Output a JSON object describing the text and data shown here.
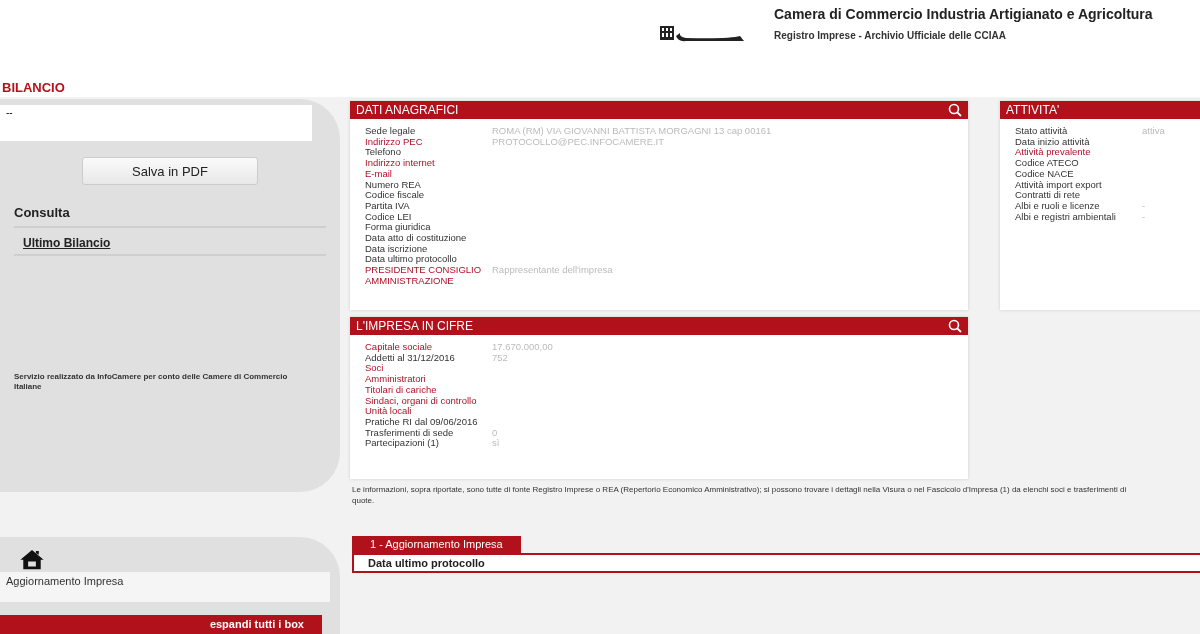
{
  "header": {
    "title": "Camera di Commercio Industria Artigianato e Agricoltura",
    "subtitle": "Registro Imprese - Archivio Ufficiale delle CCIAA"
  },
  "page_title": "BILANCIO",
  "sidebar": {
    "company_line": "--",
    "save_button": "Salva in PDF",
    "section_title": "Consulta",
    "links": [
      {
        "label": "Ultimo Bilancio",
        "selected": true
      }
    ],
    "footer_note": "Servizio realizzato da InfoCamere per conto delle Camere di Commercio Italiane"
  },
  "sidebar_bottom": {
    "item": "Aggiornamento Impresa",
    "expand_button": "espandi tutti i box"
  },
  "dati_anagrafici": {
    "title": "DATI ANAGRAFICI",
    "rows": [
      {
        "label": "Sede legale",
        "kind": "plain",
        "value": "ROMA  (RM) VIA GIOVANNI BATTISTA MORGAGNI 13  cap 00161"
      },
      {
        "label": "Indirizzo PEC",
        "kind": "link",
        "value": "PROTOCOLLO@PEC.INFOCAMERE.IT"
      },
      {
        "label": "Telefono",
        "kind": "plain"
      },
      {
        "label": "Indirizzo internet",
        "kind": "link"
      },
      {
        "label": "E-mail",
        "kind": "link"
      },
      {
        "label": "Numero REA",
        "kind": "plain"
      },
      {
        "label": "Codice fiscale",
        "kind": "plain"
      },
      {
        "label": "Partita IVA",
        "kind": "plain"
      },
      {
        "label": "Codice LEI",
        "kind": "plain"
      },
      {
        "label": "Forma giuridica",
        "kind": "plain"
      },
      {
        "label": "Data atto di costituzione",
        "kind": "plain"
      },
      {
        "label": "Data iscrizione",
        "kind": "plain"
      },
      {
        "label": "Data ultimo protocollo",
        "kind": "plain"
      },
      {
        "label": "PRESIDENTE CONSIGLIO AMMINISTRAZIONE",
        "kind": "link",
        "value": "Rappresentante dell'impresa"
      }
    ]
  },
  "attivita": {
    "title": "ATTIVITA'",
    "rows": [
      {
        "label": "Stato attività",
        "kind": "plain",
        "value": "attiva"
      },
      {
        "label": "Data inizio attività",
        "kind": "plain"
      },
      {
        "label": "Attività prevalente",
        "kind": "link"
      },
      {
        "label": "Codice ATECO",
        "kind": "plain"
      },
      {
        "label": "Codice NACE",
        "kind": "plain"
      },
      {
        "label": "Attività import export",
        "kind": "plain"
      },
      {
        "label": "Contratti di rete",
        "kind": "plain"
      },
      {
        "label": "Albi e ruoli e licenze",
        "kind": "plain",
        "value": "-"
      },
      {
        "label": "Albi e registri ambientali",
        "kind": "plain",
        "value": "-"
      }
    ]
  },
  "impresa_in_cifre": {
    "title": "L'IMPRESA IN CIFRE",
    "rows": [
      {
        "label": "Capitale sociale",
        "kind": "link",
        "value": "17.670.000,00"
      },
      {
        "label": "Addetti al 31/12/2016",
        "kind": "plain",
        "value": "752"
      },
      {
        "label": "Soci",
        "kind": "link"
      },
      {
        "label": "Amministratori",
        "kind": "link"
      },
      {
        "label": "Titolari di cariche",
        "kind": "link"
      },
      {
        "label": "Sindaci, organi di controllo",
        "kind": "link"
      },
      {
        "label": "Unità locali",
        "kind": "link"
      },
      {
        "label": "Pratiche RI dal 09/06/2016",
        "kind": "plain"
      },
      {
        "label": "Trasferimenti di sede",
        "kind": "plain",
        "value": "0"
      },
      {
        "label": "Partecipazioni (1)",
        "kind": "plain",
        "value": "sì"
      }
    ]
  },
  "note": "Le informazioni, sopra riportate, sono tutte di fonte Registro Imprese o REA (Repertorio Economico Amministrativo); si possono trovare i dettagli nella Visura o nel Fascicolo d'Impresa (1) da elenchi soci e trasferimenti di quote.",
  "section": {
    "tab": "1 - Aggiornamento Impresa",
    "row": "Data ultimo protocollo"
  }
}
